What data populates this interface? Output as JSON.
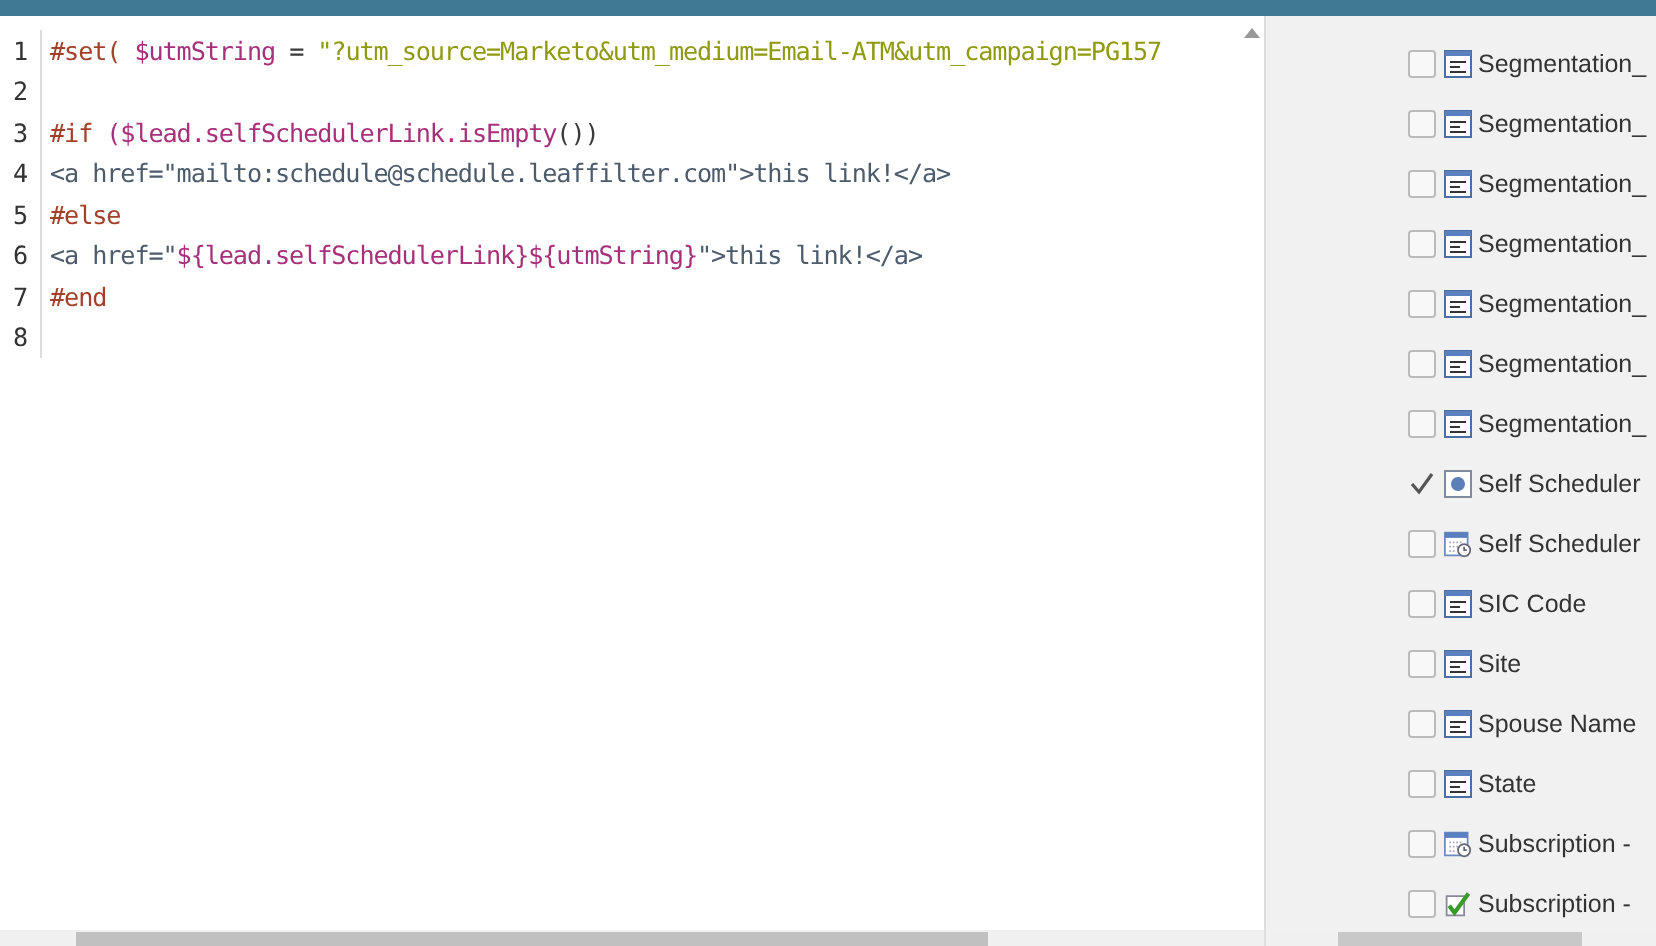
{
  "editor": {
    "lines": [
      {
        "number": "1",
        "tokens": [
          {
            "kind": "directive",
            "text": "#set( "
          },
          {
            "kind": "variable",
            "text": "$utmString"
          },
          {
            "kind": "plain",
            "text": " = "
          },
          {
            "kind": "string",
            "text": "\"?utm_source=Marketo&utm_medium=Email-ATM&utm_campaign=PG157"
          }
        ]
      },
      {
        "number": "2"
      },
      {
        "number": "3",
        "tokens": [
          {
            "kind": "directive",
            "text": "#if "
          },
          {
            "kind": "variable",
            "text": "($lead.selfSchedulerLink.isEmpty"
          },
          {
            "kind": "plain",
            "text": "())"
          }
        ]
      },
      {
        "number": "4",
        "tokens": [
          {
            "kind": "tag",
            "text": "<a href=\"mailto:schedule@schedule.leaffilter.com\">this link!</a>"
          }
        ]
      },
      {
        "number": "5",
        "tokens": [
          {
            "kind": "directive",
            "text": "#else"
          }
        ]
      },
      {
        "number": "6",
        "tokens": [
          {
            "kind": "tag",
            "text": "<a href=\""
          },
          {
            "kind": "variable",
            "text": "${lead.selfSchedulerLink}${utmString}"
          },
          {
            "kind": "tag",
            "text": "\">this link!</a>"
          }
        ]
      },
      {
        "number": "7",
        "tokens": [
          {
            "kind": "directive",
            "text": "#end"
          }
        ]
      },
      {
        "number": "8"
      }
    ]
  },
  "fields": [
    {
      "label": "Segmentation_",
      "kind": "text",
      "checked": false
    },
    {
      "label": "Segmentation_",
      "kind": "text",
      "checked": false
    },
    {
      "label": "Segmentation_",
      "kind": "text",
      "checked": false
    },
    {
      "label": "Segmentation_",
      "kind": "text",
      "checked": false
    },
    {
      "label": "Segmentation_",
      "kind": "text",
      "checked": false
    },
    {
      "label": "Segmentation_",
      "kind": "text",
      "checked": false
    },
    {
      "label": "Segmentation_",
      "kind": "text",
      "checked": false
    },
    {
      "label": "Self Scheduler",
      "kind": "url",
      "checked": true
    },
    {
      "label": "Self Scheduler",
      "kind": "date",
      "checked": false
    },
    {
      "label": "SIC Code",
      "kind": "text",
      "checked": false
    },
    {
      "label": "Site",
      "kind": "text",
      "checked": false
    },
    {
      "label": "Spouse Name",
      "kind": "text",
      "checked": false
    },
    {
      "label": "State",
      "kind": "text",
      "checked": false
    },
    {
      "label": "Subscription -",
      "kind": "date",
      "checked": false
    },
    {
      "label": "Subscription -",
      "kind": "boolean",
      "checked": false
    }
  ]
}
